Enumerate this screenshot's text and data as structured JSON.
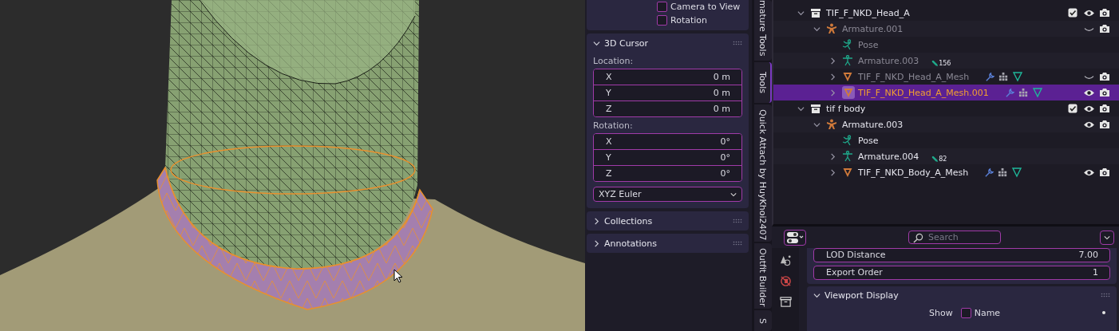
{
  "sidebar": {
    "view_options": [
      {
        "label": "Camera to View",
        "checked": false
      },
      {
        "label": "Rotation",
        "checked": false
      }
    ],
    "panels": [
      {
        "title": "3D Cursor",
        "expanded": true,
        "groups": [
          {
            "label": "Location:",
            "fields": [
              {
                "axis": "X",
                "value": "0 m"
              },
              {
                "axis": "Y",
                "value": "0 m"
              },
              {
                "axis": "Z",
                "value": "0 m"
              }
            ]
          },
          {
            "label": "Rotation:",
            "fields": [
              {
                "axis": "X",
                "value": "0°"
              },
              {
                "axis": "Y",
                "value": "0°"
              },
              {
                "axis": "Z",
                "value": "0°"
              }
            ]
          }
        ],
        "mode": "XYZ Euler"
      },
      {
        "title": "Collections",
        "expanded": false
      },
      {
        "title": "Annotations",
        "expanded": false
      }
    ]
  },
  "sidebar_tabs": [
    {
      "label": "mature Tools",
      "selected": false
    },
    {
      "label": "Tools",
      "selected": true
    },
    {
      "label": "Quick Attach by HuyKhoi2407",
      "selected": false
    },
    {
      "label": "Outfit Builder",
      "selected": false
    },
    {
      "label": "S",
      "selected": false
    }
  ],
  "outliner": {
    "rows": [
      {
        "name": "TIF_F_NKD_Head_A",
        "kind": "collection",
        "expanded": true,
        "dimmed": false,
        "selected": false,
        "checked": true,
        "visible": true,
        "camera": true,
        "children": [
          {
            "name": "Armature.001",
            "kind": "armature",
            "expanded": true,
            "dimmed": true,
            "selected": false,
            "visible": false,
            "camera": true,
            "children": [
              {
                "name": "Pose",
                "kind": "pose",
                "dimmed": true,
                "selected": false
              },
              {
                "name": "Armature.003",
                "kind": "rig",
                "expanded": false,
                "dimmed": true,
                "selected": false,
                "badge": "156"
              },
              {
                "name": "TIF_F_NKD_Head_A_Mesh",
                "kind": "mesh",
                "expanded": false,
                "dimmed": true,
                "selected": false,
                "visible": false,
                "camera": true
              },
              {
                "name": "TIF_F_NKD_Head_A_Mesh.001",
                "kind": "mesh",
                "expanded": false,
                "dimmed": false,
                "selected": true,
                "visible": true,
                "camera": true
              }
            ]
          }
        ]
      },
      {
        "name": "tif f body",
        "kind": "collection",
        "expanded": true,
        "dimmed": false,
        "selected": false,
        "checked": true,
        "visible": true,
        "camera": true,
        "children": [
          {
            "name": "Armature.003",
            "kind": "armature",
            "expanded": true,
            "dimmed": false,
            "selected": false,
            "visible": true,
            "camera": true,
            "children": [
              {
                "name": "Pose",
                "kind": "pose",
                "dimmed": false,
                "selected": false
              },
              {
                "name": "Armature.004",
                "kind": "rig",
                "expanded": false,
                "dimmed": false,
                "selected": false,
                "badge": "82"
              },
              {
                "name": "TIF_F_NKD_Body_A_Mesh",
                "kind": "mesh",
                "expanded": false,
                "dimmed": false,
                "selected": false,
                "visible": true,
                "camera": true
              }
            ]
          }
        ]
      }
    ]
  },
  "properties": {
    "search": {
      "placeholder": "Search"
    },
    "fields": [
      {
        "label": "LOD Distance",
        "value": "7.00"
      },
      {
        "label": "Export Order",
        "value": "1"
      }
    ],
    "section": {
      "title": "Viewport Display",
      "expanded": true
    },
    "show": {
      "label": "Show",
      "option": "Name",
      "checked": false
    }
  }
}
